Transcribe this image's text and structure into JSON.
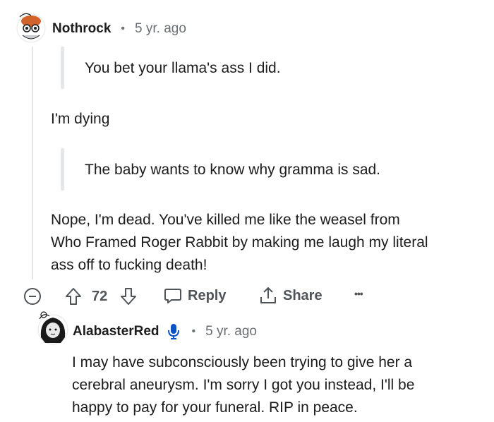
{
  "comment1": {
    "username": "Nothrock",
    "separator": "•",
    "time": "5 yr. ago",
    "quote1": "You bet your llama's ass I did.",
    "line1": "I'm dying",
    "quote2": "The baby wants to know why gramma is sad.",
    "body_lines": [
      "Nope, I'm dead. You've killed me like the weasel from",
      "Who Framed Roger Rabbit by making me laugh my literal",
      "ass off to fucking death!"
    ],
    "actions": {
      "collapse_icon": "minus-circle-icon",
      "upvote_icon": "arrow-up-icon",
      "score": "72",
      "downvote_icon": "arrow-down-icon",
      "reply_label": "Reply",
      "share_label": "Share",
      "more_label": "•••"
    }
  },
  "comment2": {
    "username": "AlabasterRed",
    "badge_icon": "microphone-icon",
    "separator": "•",
    "time": "5 yr. ago",
    "body_lines": [
      "I may have subconsciously been trying to give her a",
      "cerebral aneurysm. I'm sorry I got you instead, I'll be",
      "happy to pay for your funeral. RIP in peace."
    ]
  },
  "colors": {
    "text": "#1c1c1c",
    "muted": "#6b6f73",
    "line": "#e5e6e8",
    "badge": "#0a53c6"
  }
}
